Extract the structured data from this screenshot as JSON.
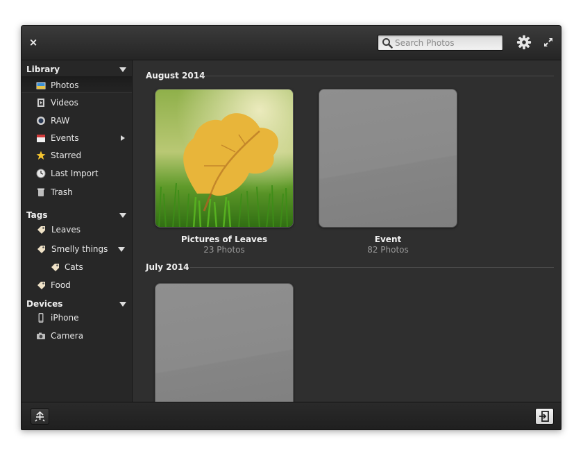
{
  "header": {
    "close_label": "×",
    "search_placeholder": "Search Photos"
  },
  "sidebar": {
    "library": {
      "title": "Library",
      "items": [
        {
          "label": "Photos",
          "icon": "photos-icon",
          "selected": true
        },
        {
          "label": "Videos",
          "icon": "film-icon"
        },
        {
          "label": "RAW",
          "icon": "lens-icon"
        },
        {
          "label": "Events",
          "icon": "calendar-icon"
        },
        {
          "label": "Starred",
          "icon": "star-icon"
        },
        {
          "label": "Last Import",
          "icon": "clock-icon"
        },
        {
          "label": "Trash",
          "icon": "trash-icon"
        }
      ]
    },
    "tags": {
      "title": "Tags",
      "items": [
        {
          "label": "Leaves",
          "icon": "tag-icon"
        },
        {
          "label": "Smelly things",
          "icon": "tag-icon"
        },
        {
          "label": "Cats",
          "icon": "tag-icon"
        },
        {
          "label": "Food",
          "icon": "tag-icon"
        }
      ]
    },
    "devices": {
      "title": "Devices",
      "items": [
        {
          "label": "iPhone",
          "icon": "phone-icon"
        },
        {
          "label": "Camera",
          "icon": "camera-icon"
        }
      ]
    }
  },
  "main": {
    "groups": [
      {
        "date": "August 2014",
        "albums": [
          {
            "title": "Pictures of Leaves",
            "count": "23 Photos"
          },
          {
            "title": "Event",
            "count": "82 Photos"
          }
        ]
      },
      {
        "date": "July 2014",
        "albums": [
          {
            "title": "",
            "count": ""
          }
        ]
      }
    ]
  },
  "colors": {
    "window_bg": "#2f2f2f",
    "sidebar_bg": "#272727",
    "header_top": "#3b3b3b",
    "text_primary": "#f0f0f0",
    "text_secondary": "#9a9a9a"
  }
}
